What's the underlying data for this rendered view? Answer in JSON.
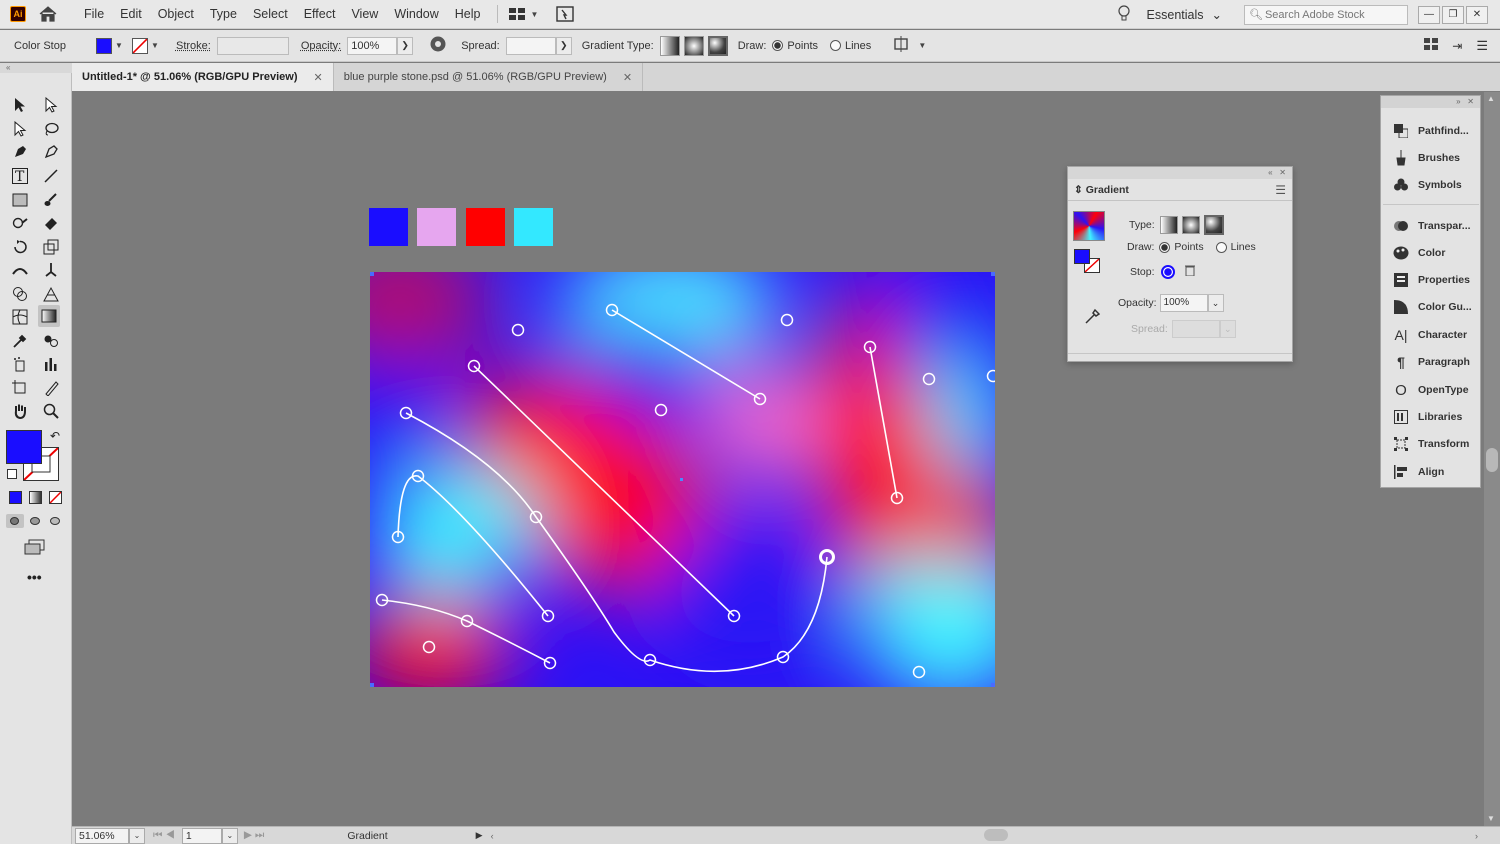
{
  "app": {
    "logo": "Ai"
  },
  "menu": [
    "File",
    "Edit",
    "Object",
    "Type",
    "Select",
    "Effect",
    "View",
    "Window",
    "Help"
  ],
  "workspace": {
    "label": "Essentials"
  },
  "stock_search": {
    "placeholder": "Search Adobe Stock"
  },
  "control_bar": {
    "context_label": "Color Stop",
    "fill_color": "#1a0dff",
    "stroke_label": "Stroke:",
    "opacity_label": "Opacity:",
    "opacity_value": "100%",
    "spread_label": "Spread:",
    "gradient_type_label": "Gradient Type:",
    "draw_label": "Draw:",
    "points_label": "Points",
    "lines_label": "Lines"
  },
  "tabs": [
    {
      "title": "Untitled-1* @ 51.06% (RGB/GPU Preview)",
      "active": true
    },
    {
      "title": "blue purple stone.psd @ 51.06% (RGB/GPU Preview)",
      "active": false
    }
  ],
  "swatches": [
    "#1a0dff",
    "#e6a6ef",
    "#ff0000",
    "#33e8ff"
  ],
  "gradient_panel": {
    "title": "Gradient",
    "type_label": "Type:",
    "draw_label": "Draw:",
    "points_label": "Points",
    "lines_label": "Lines",
    "stop_label": "Stop:",
    "opacity_label": "Opacity:",
    "opacity_value": "100%",
    "spread_label": "Spread:"
  },
  "dock_panels": [
    "Pathfind...",
    "Brushes",
    "Symbols",
    "Transpar...",
    "Color",
    "Properties",
    "Color Gu...",
    "Character",
    "Paragraph",
    "OpenType",
    "Libraries",
    "Transform",
    "Align"
  ],
  "status_bar": {
    "zoom": "51.06%",
    "artboard_number": "1",
    "tool_label": "Gradient"
  },
  "icons": {
    "home": "home-icon",
    "bulb": "lightbulb-icon",
    "search": "search-icon",
    "eyedropper": "eyedropper-icon",
    "trash": "trash-icon",
    "menu": "hamburger-menu-icon"
  }
}
